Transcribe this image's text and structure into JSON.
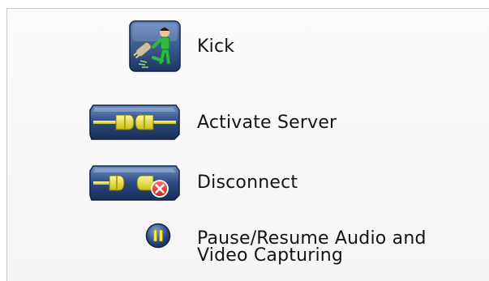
{
  "items": [
    {
      "label": "Kick",
      "icon": "kick-user-icon"
    },
    {
      "label": "Activate Server",
      "icon": "plug-connected-icon"
    },
    {
      "label": "Disconnect",
      "icon": "plug-disconnect-icon"
    },
    {
      "label": "Pause/Resume Audio and Video Capturing",
      "icon": "pause-icon"
    }
  ],
  "colors": {
    "icon_navy": "#1f3a66",
    "icon_light_blue": "#6b8fc6",
    "plug_yellow": "#e8e23a",
    "figure_green": "#2fb84a",
    "error_red": "#d9332c"
  }
}
